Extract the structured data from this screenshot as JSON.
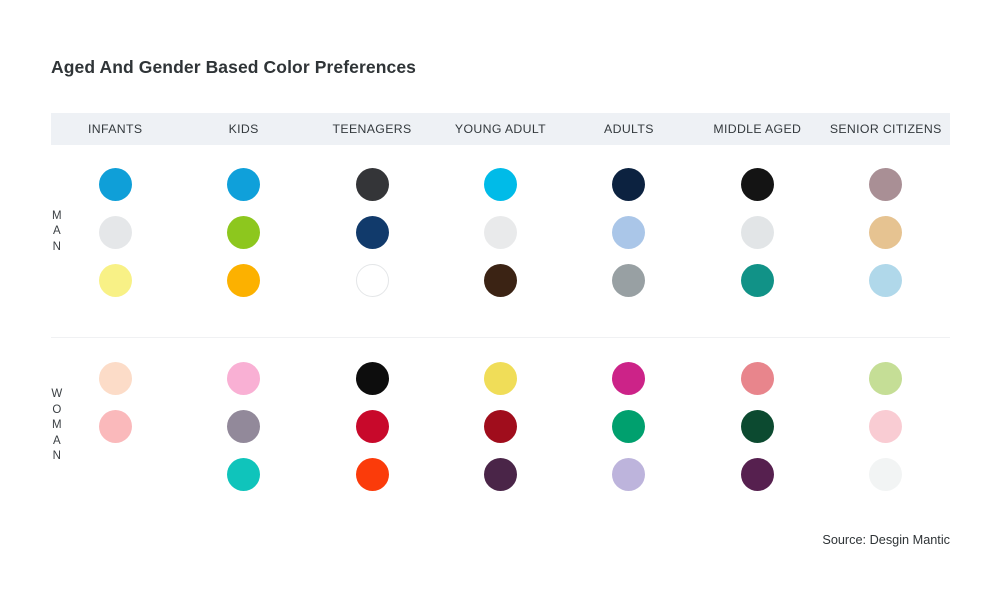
{
  "header": {
    "title": "Aged And Gender Based Color Preferences"
  },
  "footer": {
    "source": "Source: Desgin Mantic"
  },
  "theme": {
    "page_background": "#ffffff",
    "header_band_background": "#eef1f5",
    "title_color": "#2f3437",
    "header_text_color": "#33393d",
    "divider_color": "#f0f1f3"
  },
  "chart_data": {
    "type": "heatmap",
    "title": "Aged And Gender Based Color Preferences",
    "subtitle": "",
    "xlabel": "",
    "ylabel": "",
    "grid": false,
    "legend_position": "none",
    "annotations": [
      "Source: Desgin Mantic"
    ],
    "categories": [
      "INFANTS",
      "KIDS",
      "TEENAGERS",
      "YOUNG ADULT",
      "ADULTS",
      "MIDDLE AGED",
      "SENIOR CITIZENS"
    ],
    "row_groups": [
      "MAN",
      "WOMAN"
    ],
    "swatches_per_cell": 3,
    "series": [
      {
        "name": "MAN",
        "label_letters": [
          "M",
          "A",
          "N"
        ],
        "cells": [
          {
            "category": "INFANTS",
            "colors": [
              "#0f9fd8",
              "#e5e7e9",
              "#f8f186"
            ],
            "borders": [
              false,
              false,
              false
            ]
          },
          {
            "category": "KIDS",
            "colors": [
              "#0fa0da",
              "#8dc71e",
              "#fcb100"
            ],
            "borders": [
              false,
              false,
              false
            ]
          },
          {
            "category": "TEENAGERS",
            "colors": [
              "#343538",
              "#113a6b",
              "#ffffff"
            ],
            "borders": [
              false,
              false,
              true
            ]
          },
          {
            "category": "YOUNG ADULT",
            "colors": [
              "#00bbe8",
              "#e9eaeb",
              "#3b2314"
            ],
            "borders": [
              false,
              false,
              false
            ]
          },
          {
            "category": "ADULTS",
            "colors": [
              "#0c2240",
              "#aac6e8",
              "#98a0a3"
            ],
            "borders": [
              false,
              false,
              false
            ]
          },
          {
            "category": "MIDDLE AGED",
            "colors": [
              "#141414",
              "#e2e5e7",
              "#119287"
            ],
            "borders": [
              false,
              false,
              false
            ]
          },
          {
            "category": "SENIOR CITIZENS",
            "colors": [
              "#a98f95",
              "#e6c391",
              "#b0d8ea"
            ],
            "borders": [
              false,
              false,
              false
            ]
          }
        ]
      },
      {
        "name": "WOMAN",
        "label_letters": [
          "W",
          "O",
          "M",
          "A",
          "N"
        ],
        "cells": [
          {
            "category": "INFANTS",
            "colors": [
              "#fcdcc8",
              "#fab9bb",
              "#f9a košice"
            ],
            "borders": [
              false,
              false,
              false
            ]
          },
          {
            "category": "KIDS",
            "colors": [
              "#f9b0d4",
              "#92899a",
              "#0fc4bb"
            ],
            "borders": [
              false,
              false,
              false
            ]
          },
          {
            "category": "TEENAGERS",
            "colors": [
              "#0d0d0d",
              "#c8092b",
              "#fb3b0a"
            ],
            "borders": [
              false,
              false,
              false
            ]
          },
          {
            "category": "YOUNG ADULT",
            "colors": [
              "#f0dd58",
              "#a00d1c",
              "#4a2548"
            ],
            "borders": [
              false,
              false,
              false
            ]
          },
          {
            "category": "ADULTS",
            "colors": [
              "#cc2388",
              "#00a06e",
              "#bdb4dc"
            ],
            "borders": [
              false,
              false,
              false
            ]
          },
          {
            "category": "MIDDLE AGED",
            "colors": [
              "#e8858c",
              "#0c4a30",
              "#56204f"
            ],
            "borders": [
              false,
              false,
              false
            ]
          },
          {
            "category": "SENIOR CITIZENS",
            "colors": [
              "#c5de96",
              "#f9ccd3",
              "#f2f4f4"
            ],
            "borders": [
              false,
              false,
              false
            ]
          }
        ]
      }
    ]
  }
}
